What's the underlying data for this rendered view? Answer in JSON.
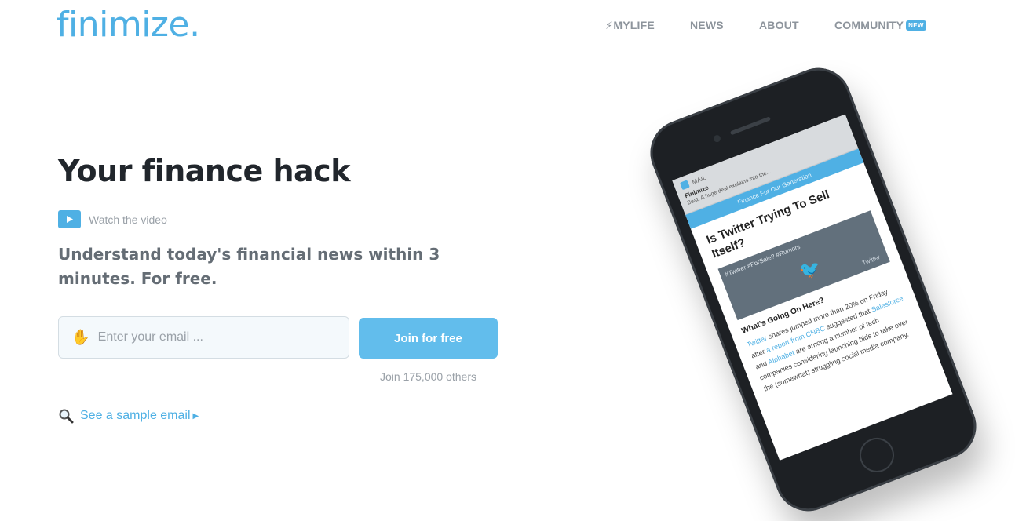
{
  "header": {
    "logo": "finimize.",
    "nav": [
      {
        "key": "mylife",
        "label": "MYLIFE",
        "icon": "lightning-icon"
      },
      {
        "key": "news",
        "label": "NEWS"
      },
      {
        "key": "about",
        "label": "ABOUT"
      },
      {
        "key": "community",
        "label": "COMMUNITY",
        "badge": "NEW"
      }
    ]
  },
  "hero": {
    "title": "Your finance hack",
    "video_label": "Watch the video",
    "subtitle": "Understand today's financial news within 3 minutes. For free.",
    "email_placeholder": "Enter your email ...",
    "join_button": "Join for free",
    "join_count": "Join 175,000 others",
    "sample_link": "See a sample email"
  },
  "phone": {
    "notification": {
      "app": "MAIL",
      "title": "Finimize",
      "body": "Beat. A huge deal explains into the..."
    },
    "brand_bar": "Finance For Our Generation",
    "article_title": "Is Twitter Trying To Sell Itself?",
    "image_caption": "#Twitter #ForSale? #Rumors",
    "image_credit": "Twitter",
    "section_heading": "What's Going On Here?",
    "body": {
      "l1": "Twitter",
      "t1": " shares jumped more than 20% on Friday after ",
      "l2": "a report from CNBC",
      "t2": " suggested that ",
      "l3": "Salesforce",
      "t3": " and ",
      "l4": "Alphabet",
      "t4": " are among a number of tech companies considering launching bids to take over the (somewhat) struggling social media company."
    }
  },
  "colors": {
    "brand": "#4fb0e4",
    "button": "#62bdec",
    "heading": "#21262c",
    "nav": "#8d949c"
  }
}
